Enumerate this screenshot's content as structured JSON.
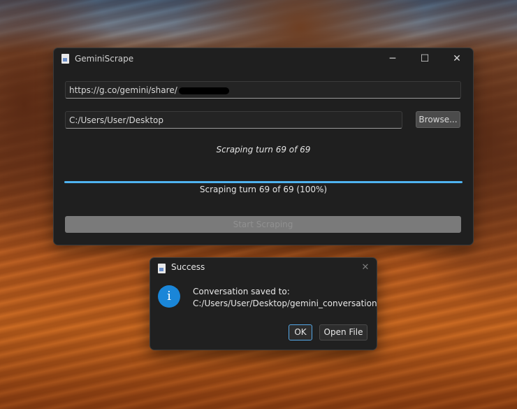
{
  "main_window": {
    "title": "GeminiScrape",
    "controls": {
      "minimize": "─",
      "maximize": "☐",
      "close": "✕"
    },
    "url_field": {
      "value": "https://g.co/gemini/share/"
    },
    "path_field": {
      "value": "C:/Users/User/Desktop"
    },
    "browse_label": "Browse...",
    "status_text": "Scraping turn 69 of 69",
    "progress": {
      "percent": 100,
      "label": "Scraping turn 69 of 69 (100%)"
    },
    "start_label": "Start Scraping"
  },
  "dialog": {
    "title": "Success",
    "close": "✕",
    "info_glyph": "i",
    "message_line1": "Conversation saved to:",
    "message_line2": "C:/Users/User/Desktop/gemini_conversation.txt",
    "ok_label": "OK",
    "open_file_label": "Open File"
  },
  "colors": {
    "accent": "#4fb3f0",
    "info": "#1a86d8"
  },
  "icons": [
    "app-icon",
    "info-icon",
    "close-icon",
    "maximize-icon",
    "minimize-icon"
  ]
}
